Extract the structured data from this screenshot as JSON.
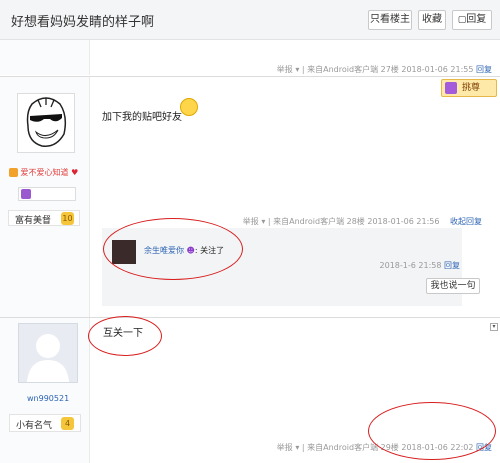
{
  "thread": {
    "title": "好想看妈妈发睛的样子啊",
    "buttons": {
      "only_op": "只看楼主",
      "collect": "收藏",
      "reply": "回复"
    }
  },
  "post1": {
    "meta": {
      "report": "举报",
      "sep": "|",
      "from": "来自Android客户端",
      "floor": "27楼",
      "time": "2018-01-06 21:55",
      "reply": "回复"
    },
    "badge": "挑尊",
    "user": {
      "name": "爱不爱心知道",
      "rank_label": "富有美督",
      "level": "10"
    },
    "content": "加下我的贴吧好友",
    "meta2": {
      "report": "举报",
      "from": "来自Android客户端",
      "floor": "28楼",
      "time": "2018-01-06 21:56",
      "collapse": "收起回复"
    },
    "subreply": {
      "user": "余生唯爱你",
      "text": "关注了",
      "time": "2018-1-6 21:58",
      "reply": "回复",
      "say_button": "我也说一句"
    }
  },
  "post2": {
    "user": {
      "name": "wn990521",
      "rank_label": "小有名气",
      "level": "4"
    },
    "content": "互关一下",
    "meta": {
      "report": "举报",
      "sep": "|",
      "from": "来自Android客户端",
      "floor": "29楼",
      "time": "2018-01-06 22:02",
      "reply": "回复"
    }
  }
}
